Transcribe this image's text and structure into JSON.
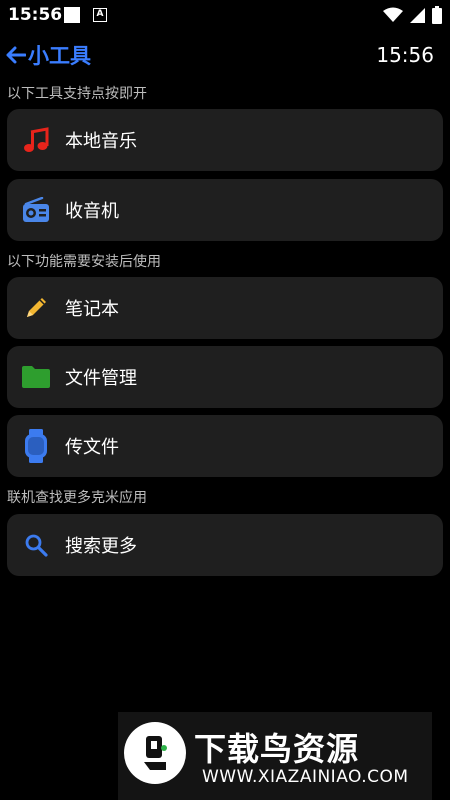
{
  "status_bar": {
    "time": "15:56",
    "indicator": "A"
  },
  "header": {
    "title": "小工具",
    "clock": "15:56"
  },
  "sections": [
    {
      "label": "以下工具支持点按即开",
      "items": [
        {
          "label": "本地音乐",
          "icon": "music-note-icon",
          "color": "#e8241b"
        },
        {
          "label": "收音机",
          "icon": "radio-icon",
          "color": "#4a86e8"
        }
      ]
    },
    {
      "label": "以下功能需要安装后使用",
      "items": [
        {
          "label": "笔记本",
          "icon": "pencil-icon",
          "color": "#f2b631"
        },
        {
          "label": "文件管理",
          "icon": "folder-icon",
          "color": "#2e9e2e"
        },
        {
          "label": "传文件",
          "icon": "watch-icon",
          "color": "#3c7bef"
        }
      ]
    },
    {
      "label": "联机查找更多克米应用",
      "items": [
        {
          "label": "搜索更多",
          "icon": "search-icon",
          "color": "#3c7bef"
        }
      ]
    }
  ],
  "watermark": {
    "name": "下载鸟资源",
    "url": "WWW.XIAZAINIAO.COM"
  },
  "colors": {
    "accent": "#3a7dff",
    "card_bg": "#1f1f1f",
    "background": "#000000"
  }
}
